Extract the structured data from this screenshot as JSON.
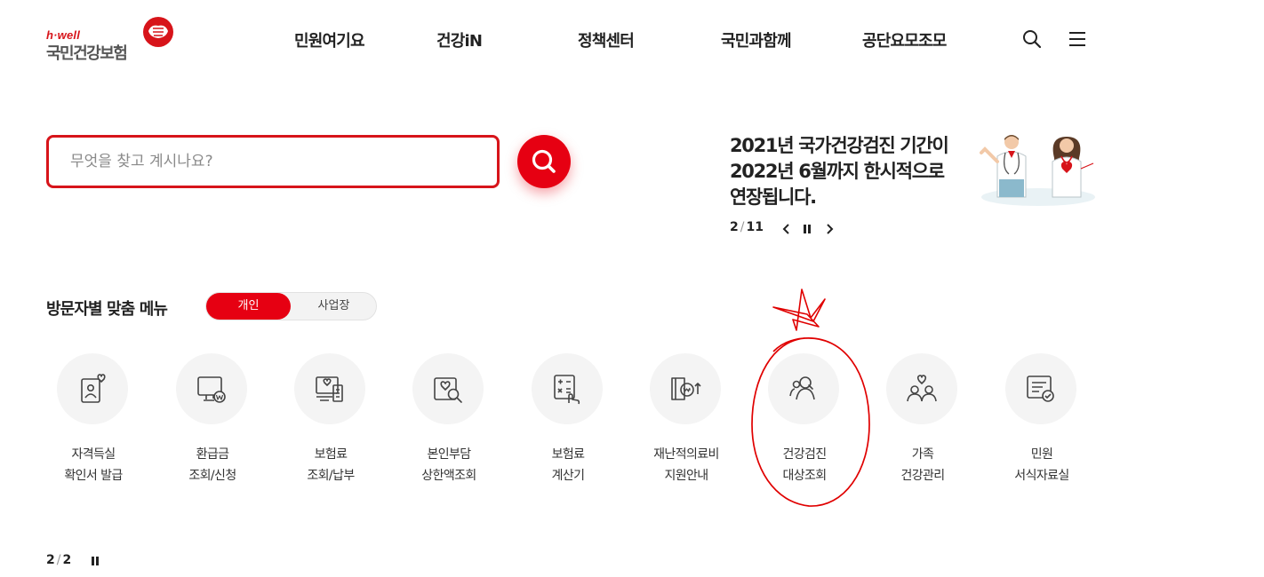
{
  "logo": {
    "sub": "h·well",
    "main": "국민건강보험",
    "icon": "nhis-logo-icon"
  },
  "nav": {
    "items": [
      "민원여기요",
      "건강iN",
      "정책센터",
      "국민과함께",
      "공단요모조모"
    ],
    "search_icon": "search-icon",
    "menu_icon": "hamburger-menu-icon"
  },
  "search": {
    "placeholder": "무엇을 찾고 계시나요?",
    "value": "",
    "button_icon": "search-icon"
  },
  "notice": {
    "title_lines": [
      "2021년 국가건강검진 기간이",
      "2022년 6월까지 한시적으로",
      "연장됩니다."
    ],
    "current": "2",
    "total": "11",
    "illustration": "doctors-illustration"
  },
  "visitor_menu": {
    "heading": "방문자별 맞춤 메뉴",
    "toggle": [
      "개인",
      "사업장"
    ],
    "selected": "개인",
    "items": [
      {
        "lines": [
          "자격득실",
          "확인서 발급"
        ],
        "icon": "id-card-icon"
      },
      {
        "lines": [
          "환급금",
          "조회/신청"
        ],
        "icon": "monitor-refund-icon"
      },
      {
        "lines": [
          "보험료",
          "조회/납부"
        ],
        "icon": "payment-terminal-icon"
      },
      {
        "lines": [
          "본인부담",
          "상한액조회"
        ],
        "icon": "heart-search-icon"
      },
      {
        "lines": [
          "보험료",
          "계산기"
        ],
        "icon": "calculator-icon"
      },
      {
        "lines": [
          "재난적의료비",
          "지원안내"
        ],
        "icon": "medical-cost-icon"
      },
      {
        "lines": [
          "건강검진",
          "대상조회"
        ],
        "icon": "people-check-icon"
      },
      {
        "lines": [
          "가족",
          "건강관리"
        ],
        "icon": "family-icon"
      },
      {
        "lines": [
          "민원",
          "서식자료실"
        ],
        "icon": "document-form-icon"
      }
    ],
    "current": "2",
    "total": "2"
  },
  "colors": {
    "brand_red": "#e60012",
    "annotation_red": "#e00000"
  }
}
